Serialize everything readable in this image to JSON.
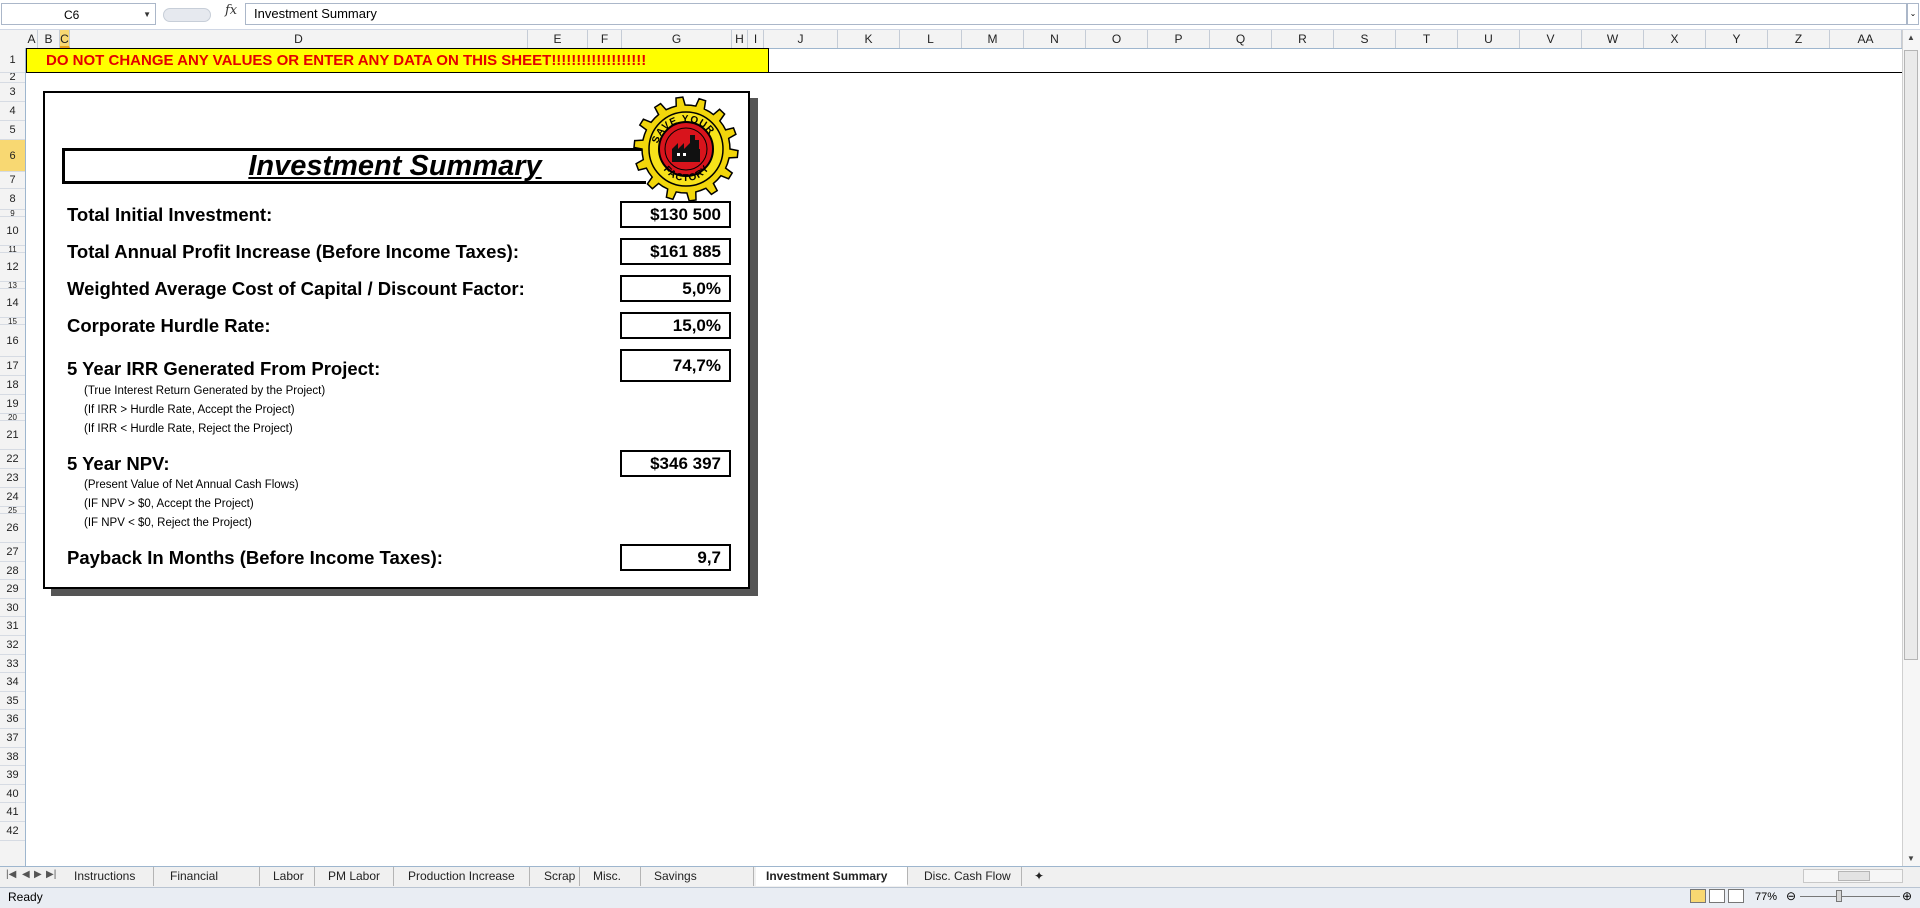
{
  "formula_bar": {
    "name_box": "C6",
    "fx_symbol": "fx",
    "formula": "Investment Summary"
  },
  "columns": [
    "A",
    "B",
    "C",
    "D",
    "E",
    "F",
    "G",
    "H",
    "I",
    "J",
    "K",
    "L",
    "M",
    "N",
    "O",
    "P",
    "Q",
    "R",
    "S",
    "T",
    "U",
    "V",
    "W",
    "X",
    "Y",
    "Z",
    "AA"
  ],
  "selected_column": "C",
  "rows": [
    "1",
    "2",
    "3",
    "4",
    "5",
    "6",
    "7",
    "8",
    "9",
    "10",
    "11",
    "12",
    "13",
    "14",
    "15",
    "16",
    "17",
    "18",
    "19",
    "20",
    "21",
    "22",
    "23",
    "24",
    "25",
    "26",
    "27",
    "28",
    "29",
    "30",
    "31",
    "32",
    "33",
    "34",
    "35",
    "36",
    "37",
    "38",
    "39",
    "40",
    "41",
    "42"
  ],
  "selected_row": "6",
  "sheet": {
    "warning": "DO NOT CHANGE ANY VALUES OR ENTER ANY DATA ON THIS SHEET!!!!!!!!!!!!!!!!!!!",
    "title": "Investment Summary",
    "logo_text_top": "SAVE YOUR",
    "logo_text_bottom": "FACTORY",
    "metrics": [
      {
        "label": "Total Initial Investment:",
        "value": "$130 500"
      },
      {
        "label": "Total Annual Profit Increase (Before Income Taxes):",
        "value": "$161 885"
      },
      {
        "label": "Weighted Average Cost of Capital / Discount Factor:",
        "value": "5,0%"
      },
      {
        "label": "Corporate Hurdle Rate:",
        "value": "15,0%"
      },
      {
        "label": "5  Year IRR Generated From Project:",
        "value": "74,7%"
      },
      {
        "label": "5  Year NPV:",
        "value": "$346 397"
      },
      {
        "label": "Payback In Months (Before Income Taxes):",
        "value": "9,7"
      }
    ],
    "irr_notes": [
      "(True Interest Return Generated by the Project)",
      "(If IRR > Hurdle Rate, Accept the Project)",
      "(If IRR < Hurdle Rate, Reject the Project)"
    ],
    "npv_notes": [
      "(Present Value of Net Annual Cash Flows)",
      "(IF NPV > $0, Accept the Project)",
      "(IF NPV < $0, Reject the Project)"
    ]
  },
  "tabs": [
    "Instructions",
    "Financial Inputs",
    "Labor",
    "PM Labor",
    "Production Increase",
    "Scrap",
    "Misc.",
    "Savings Summary",
    "Investment Summary",
    "Disc. Cash Flow"
  ],
  "active_tab": "Investment Summary",
  "status": {
    "ready": "Ready",
    "zoom": "77%"
  },
  "colors": {
    "warning_bg": "#ffff00",
    "warning_text": "#e30000",
    "header_selected": "#f8d872"
  }
}
